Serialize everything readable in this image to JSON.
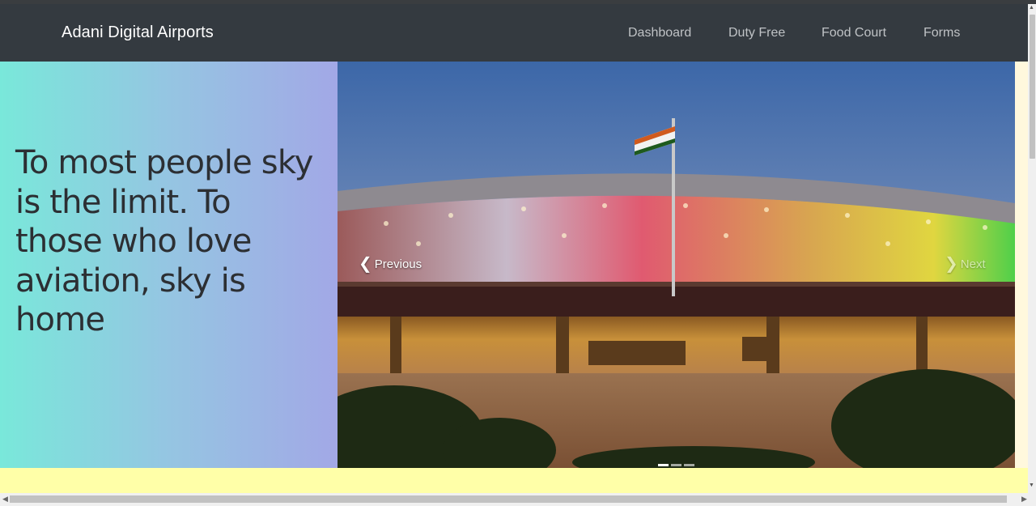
{
  "navbar": {
    "brand": "Adani Digital Airports",
    "links": [
      "Dashboard",
      "Duty Free",
      "Food Court",
      "Forms"
    ]
  },
  "hero": {
    "quote": "To most people sky is the limit. To those who love aviation, sky is home"
  },
  "carousel": {
    "prev_label": "Previous",
    "next_label": "Next",
    "indicator_count": 3,
    "active_index": 0
  },
  "colors": {
    "navbar_bg": "#343a40",
    "gradient_start": "#79e8da",
    "gradient_end": "#a2a8e6",
    "band": "#ffffa8"
  },
  "icons": [
    "chevron-left-icon",
    "chevron-right-icon"
  ]
}
